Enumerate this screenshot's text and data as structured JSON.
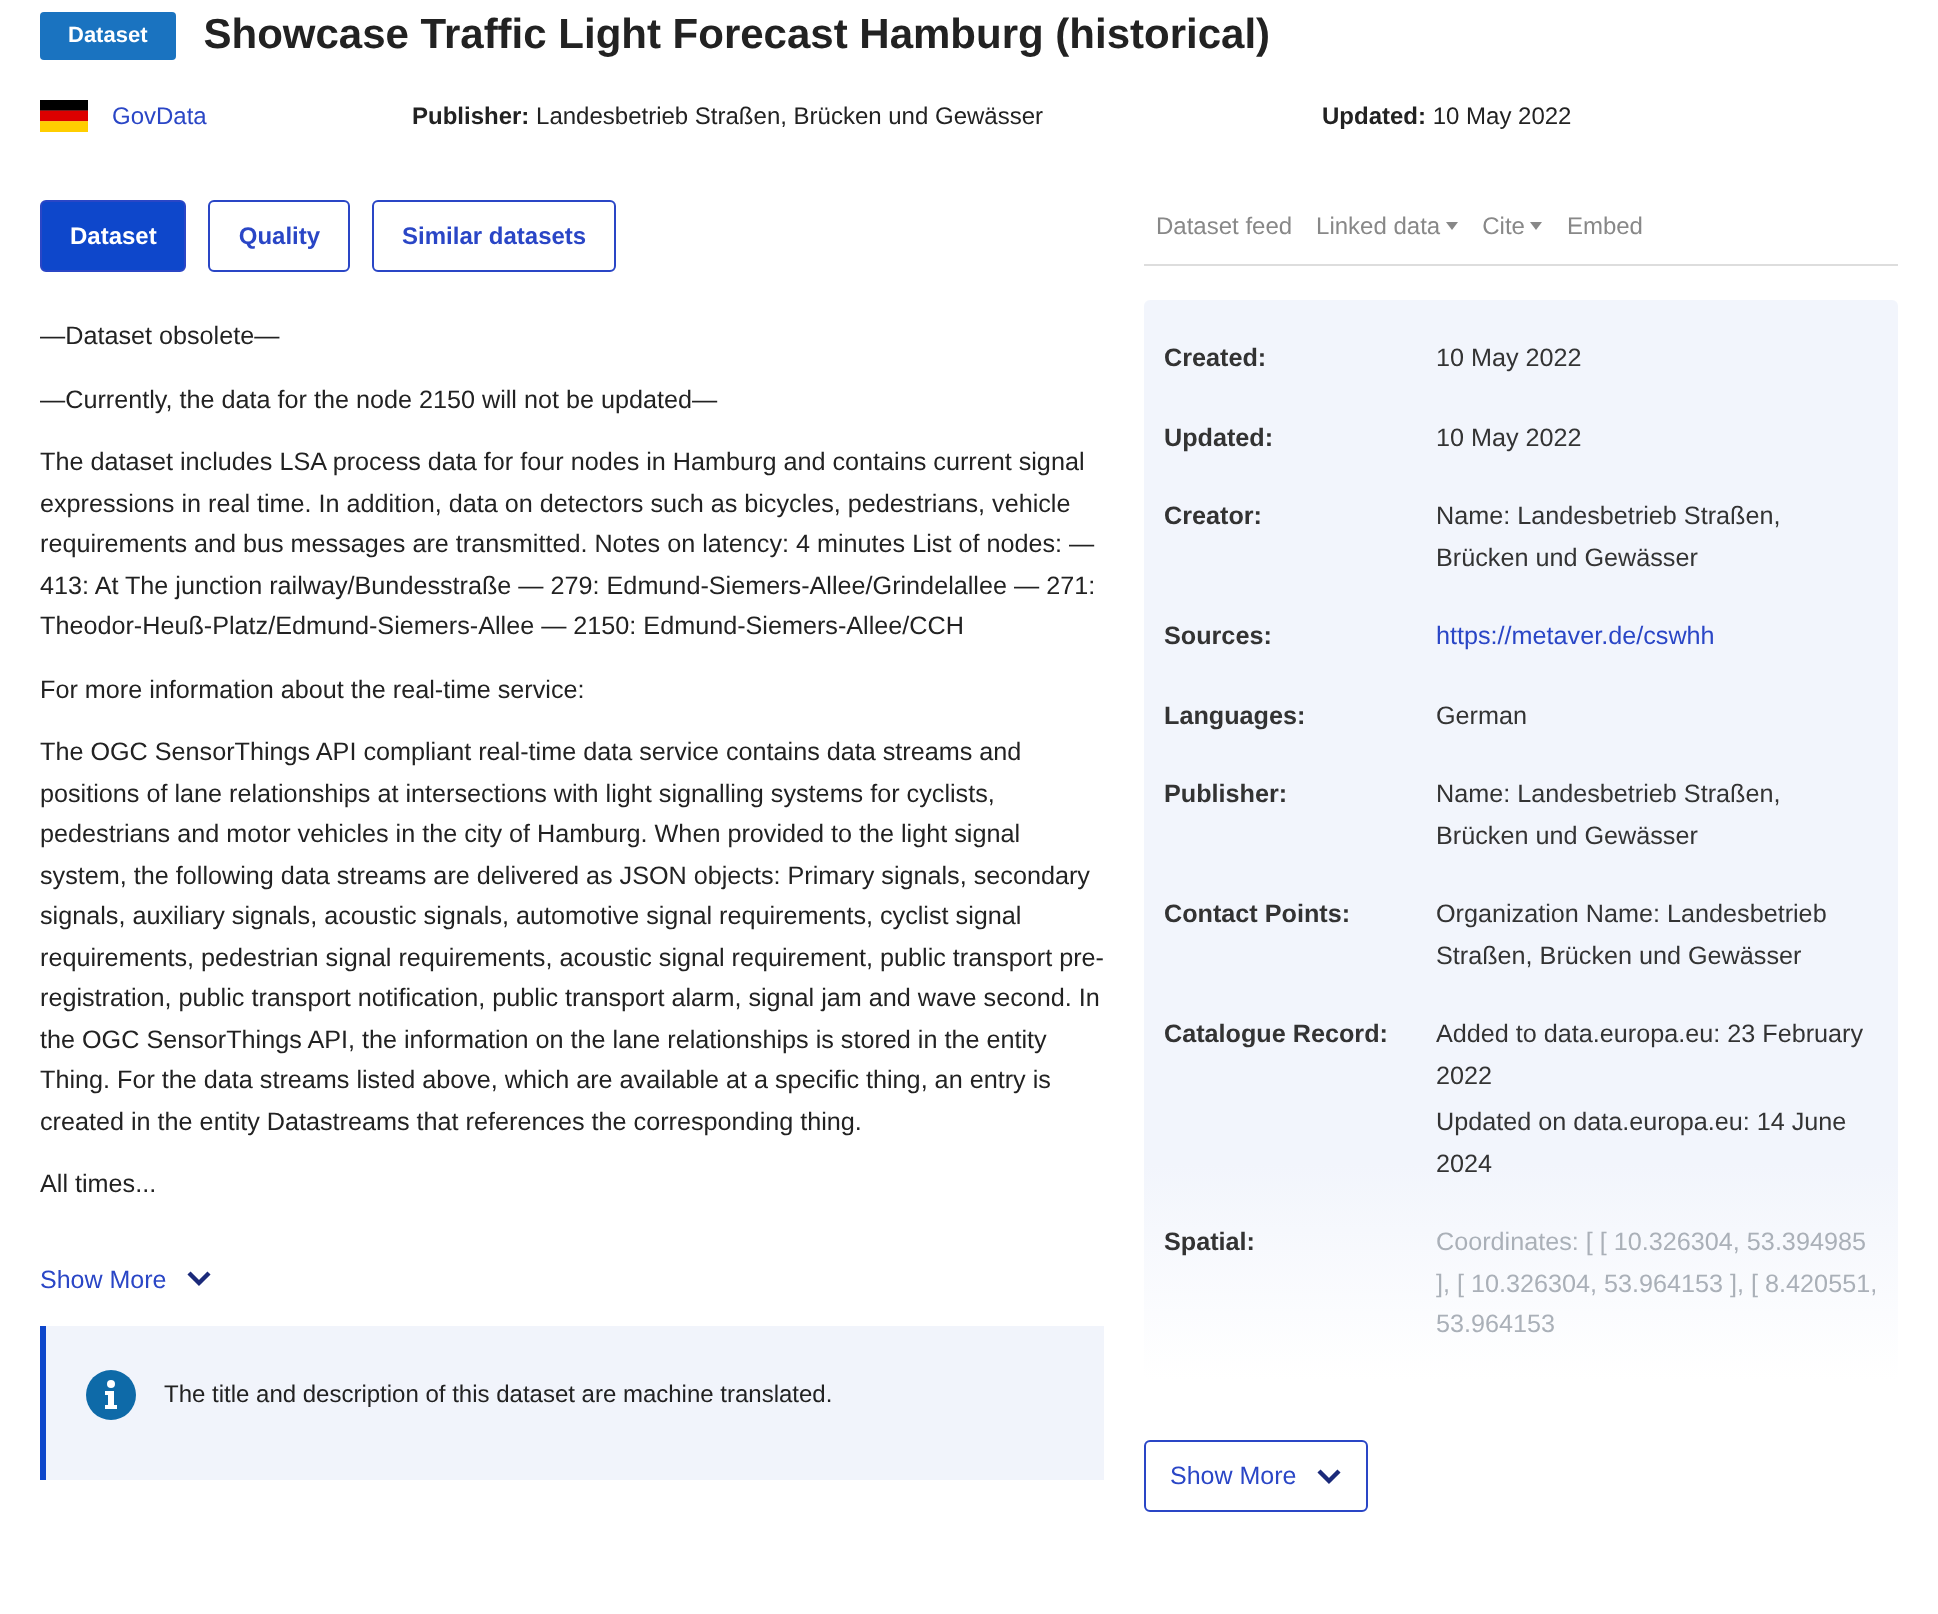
{
  "header": {
    "badge": "Dataset",
    "title": "Showcase Traffic Light Forecast Hamburg (historical)"
  },
  "meta": {
    "catalogue": "GovData",
    "publisher_label": "Publisher:",
    "publisher": "Landesbetrieb Straßen, Brücken und Gewässer",
    "updated_label": "Updated:",
    "updated": "10 May 2022"
  },
  "tabs": [
    {
      "label": "Dataset",
      "selected": true
    },
    {
      "label": "Quality",
      "selected": false
    },
    {
      "label": "Similar datasets",
      "selected": false
    }
  ],
  "actions": [
    {
      "label": "Dataset feed",
      "has_menu": false
    },
    {
      "label": "Linked data",
      "has_menu": true
    },
    {
      "label": "Cite",
      "has_menu": true
    },
    {
      "label": "Embed",
      "has_menu": false
    }
  ],
  "description": [
    "—Dataset obsolete—",
    "—Currently, the data for the node 2150 will not be updated—",
    "The dataset includes LSA process data for four nodes in Hamburg and contains current signal expressions in real time. In addition, data on detectors such as bicycles, pedestrians, vehicle requirements and bus messages are transmitted. Notes on latency: 4 minutes List of nodes: — 413: At The junction railway/Bundesstraße — 279: Edmund-Siemers-Allee/Grindelallee — 271: Theodor-Heuß-Platz/Edmund-Siemers-Allee — 2150: Edmund-Siemers-Allee/CCH",
    "For more information about the real-time service:",
    "The OGC SensorThings API compliant real-time data service contains data streams and positions of lane relationships at intersections with light signalling systems for cyclists, pedestrians and motor vehicles in the city of Hamburg. When provided to the light signal system, the following data streams are delivered as JSON objects: Primary signals, secondary signals, auxiliary signals, acoustic signals, automotive signal requirements, cyclist signal requirements, pedestrian signal requirements, acoustic signal requirement, public transport pre-registration, public transport notification, public transport alarm, signal jam and wave second. In the OGC SensorThings API, the information on the lane relationships is stored in the entity Thing. For the data streams listed above, which are available at a specific thing, an entry is created in the entity Datastreams that references the corresponding thing.",
    "All times..."
  ],
  "show_more_left": "Show More",
  "notice": "The title and description of this dataset are machine translated.",
  "details": [
    {
      "label": "Created:",
      "values": [
        "10 May 2022"
      ],
      "kind": "text"
    },
    {
      "label": "Updated:",
      "values": [
        "10 May 2022"
      ],
      "kind": "text"
    },
    {
      "label": "Creator:",
      "values": [
        "Name: Landesbetrieb Straßen, Brücken und Gewässer"
      ],
      "kind": "text"
    },
    {
      "label": "Sources:",
      "values": [
        "https://metaver.de/cswhh"
      ],
      "kind": "link"
    },
    {
      "label": "Languages:",
      "values": [
        "German"
      ],
      "kind": "text"
    },
    {
      "label": "Publisher:",
      "values": [
        "Name: Landesbetrieb Straßen, Brücken und Gewässer"
      ],
      "kind": "text"
    },
    {
      "label": "Contact Points:",
      "values": [
        "Organization Name: Landesbetrieb Straßen, Brücken und Gewässer"
      ],
      "kind": "text"
    },
    {
      "label": "Catalogue Record:",
      "values": [
        "Added to data.europa.eu: 23 February 2022",
        "Updated on data.europa.eu: 14 June 2024"
      ],
      "kind": "text"
    },
    {
      "label": "Spatial:",
      "values": [
        "Coordinates: [ [ 10.326304, 53.394985 ], [ 10.326304, 53.964153 ], [ 8.420551, 53.964153"
      ],
      "kind": "faded"
    }
  ],
  "show_more_right": "Show More"
}
